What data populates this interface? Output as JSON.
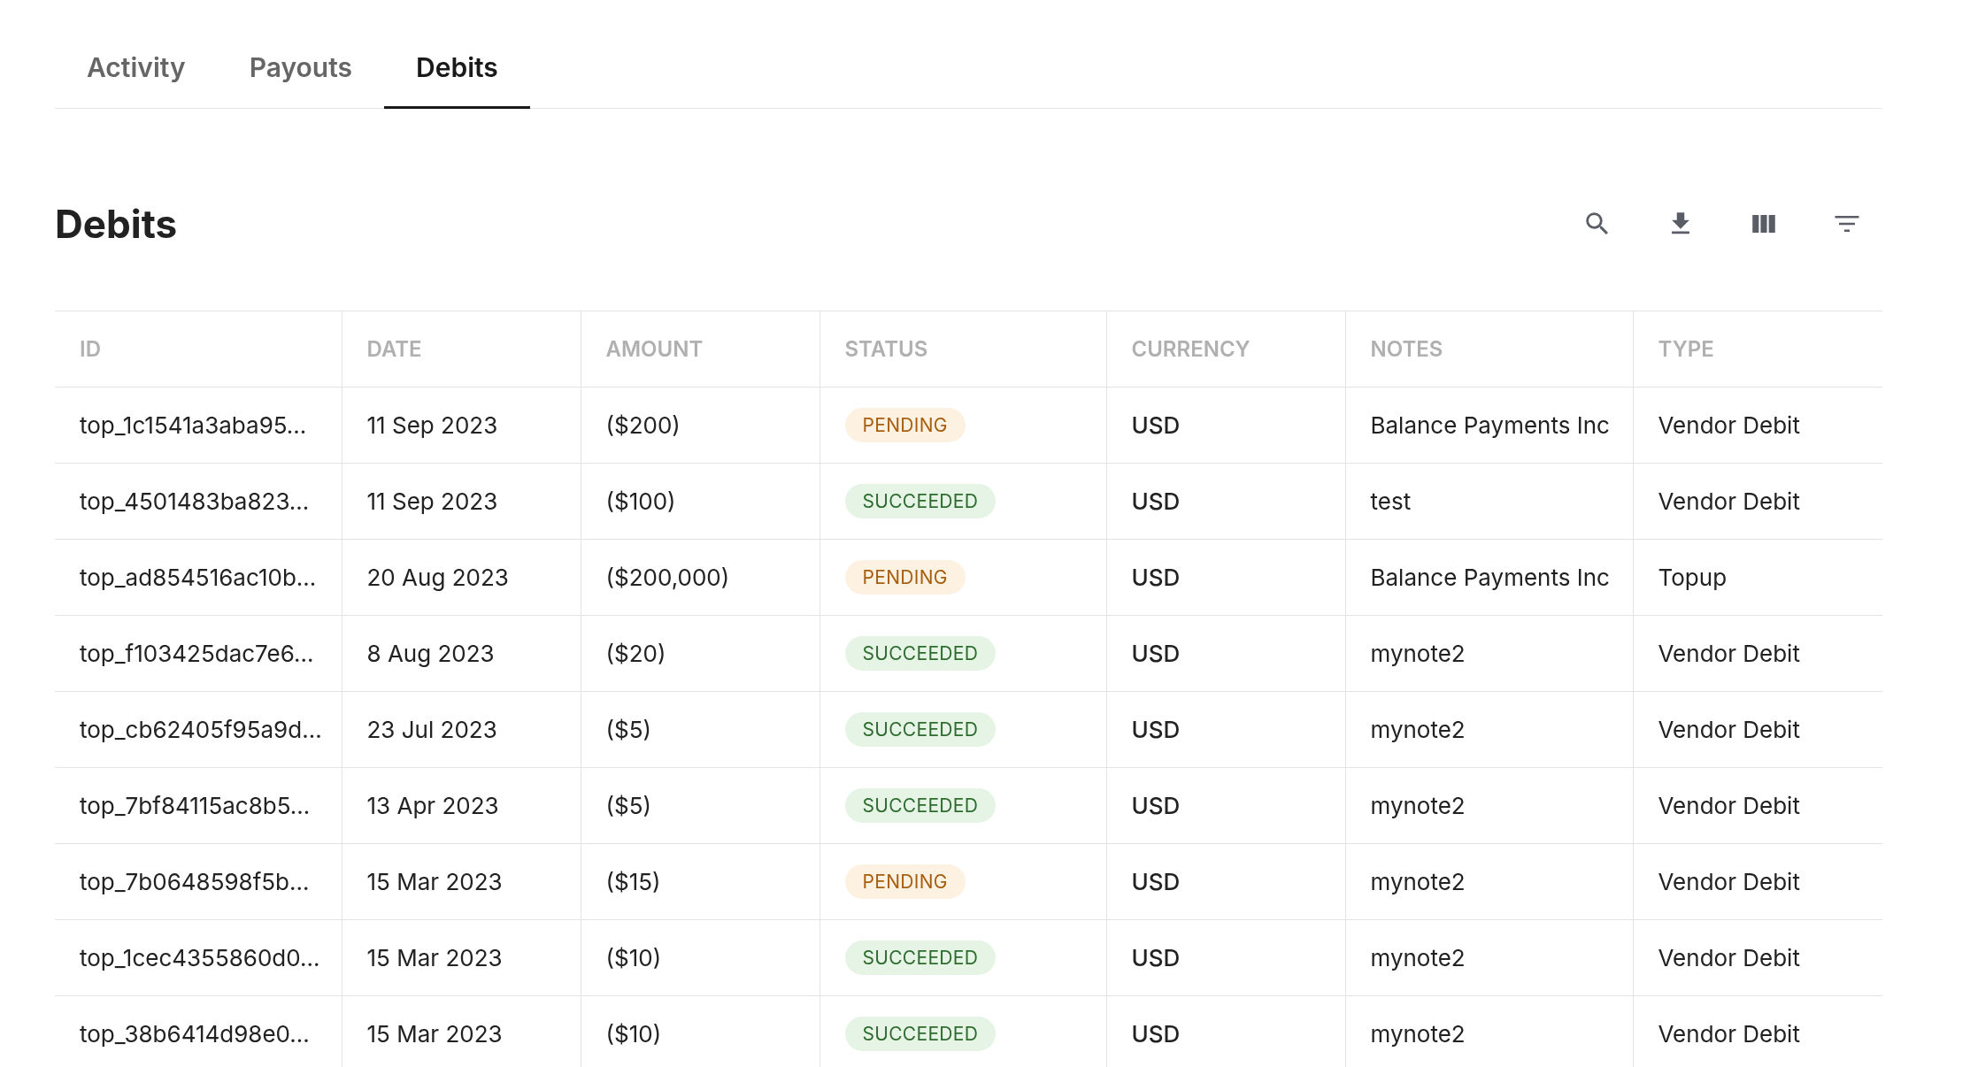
{
  "tabs": [
    {
      "label": "Activity",
      "selected": false
    },
    {
      "label": "Payouts",
      "selected": false
    },
    {
      "label": "Debits",
      "selected": true
    }
  ],
  "page_title": "Debits",
  "table": {
    "columns": [
      "ID",
      "DATE",
      "AMOUNT",
      "STATUS",
      "CURRENCY",
      "NOTES",
      "TYPE"
    ],
    "rows": [
      {
        "id": "top_1c1541a3aba95...",
        "date": "11 Sep 2023",
        "amount": "($200)",
        "status": {
          "label": "PENDING",
          "kind": "pending"
        },
        "currency": "USD",
        "notes": "Balance Payments Inc",
        "type": "Vendor Debit"
      },
      {
        "id": "top_4501483ba823...",
        "date": "11 Sep 2023",
        "amount": "($100)",
        "status": {
          "label": "SUCCEEDED",
          "kind": "succeeded"
        },
        "currency": "USD",
        "notes": "test",
        "type": "Vendor Debit"
      },
      {
        "id": "top_ad854516ac10b...",
        "date": "20 Aug 2023",
        "amount": "($200,000)",
        "status": {
          "label": "PENDING",
          "kind": "pending"
        },
        "currency": "USD",
        "notes": "Balance Payments Inc",
        "type": "Topup"
      },
      {
        "id": "top_f103425dac7e6...",
        "date": "8 Aug 2023",
        "amount": "($20)",
        "status": {
          "label": "SUCCEEDED",
          "kind": "succeeded"
        },
        "currency": "USD",
        "notes": "mynote2",
        "type": "Vendor Debit"
      },
      {
        "id": "top_cb62405f95a9d...",
        "date": "23 Jul 2023",
        "amount": "($5)",
        "status": {
          "label": "SUCCEEDED",
          "kind": "succeeded"
        },
        "currency": "USD",
        "notes": "mynote2",
        "type": "Vendor Debit"
      },
      {
        "id": "top_7bf84115ac8b5...",
        "date": "13 Apr 2023",
        "amount": "($5)",
        "status": {
          "label": "SUCCEEDED",
          "kind": "succeeded"
        },
        "currency": "USD",
        "notes": "mynote2",
        "type": "Vendor Debit"
      },
      {
        "id": "top_7b0648598f5b...",
        "date": "15 Mar 2023",
        "amount": "($15)",
        "status": {
          "label": "PENDING",
          "kind": "pending"
        },
        "currency": "USD",
        "notes": "mynote2",
        "type": "Vendor Debit"
      },
      {
        "id": "top_1cec4355860d0...",
        "date": "15 Mar 2023",
        "amount": "($10)",
        "status": {
          "label": "SUCCEEDED",
          "kind": "succeeded"
        },
        "currency": "USD",
        "notes": "mynote2",
        "type": "Vendor Debit"
      },
      {
        "id": "top_38b6414d98e0...",
        "date": "15 Mar 2023",
        "amount": "($10)",
        "status": {
          "label": "SUCCEEDED",
          "kind": "succeeded"
        },
        "currency": "USD",
        "notes": "mynote2",
        "type": "Vendor Debit"
      }
    ]
  }
}
